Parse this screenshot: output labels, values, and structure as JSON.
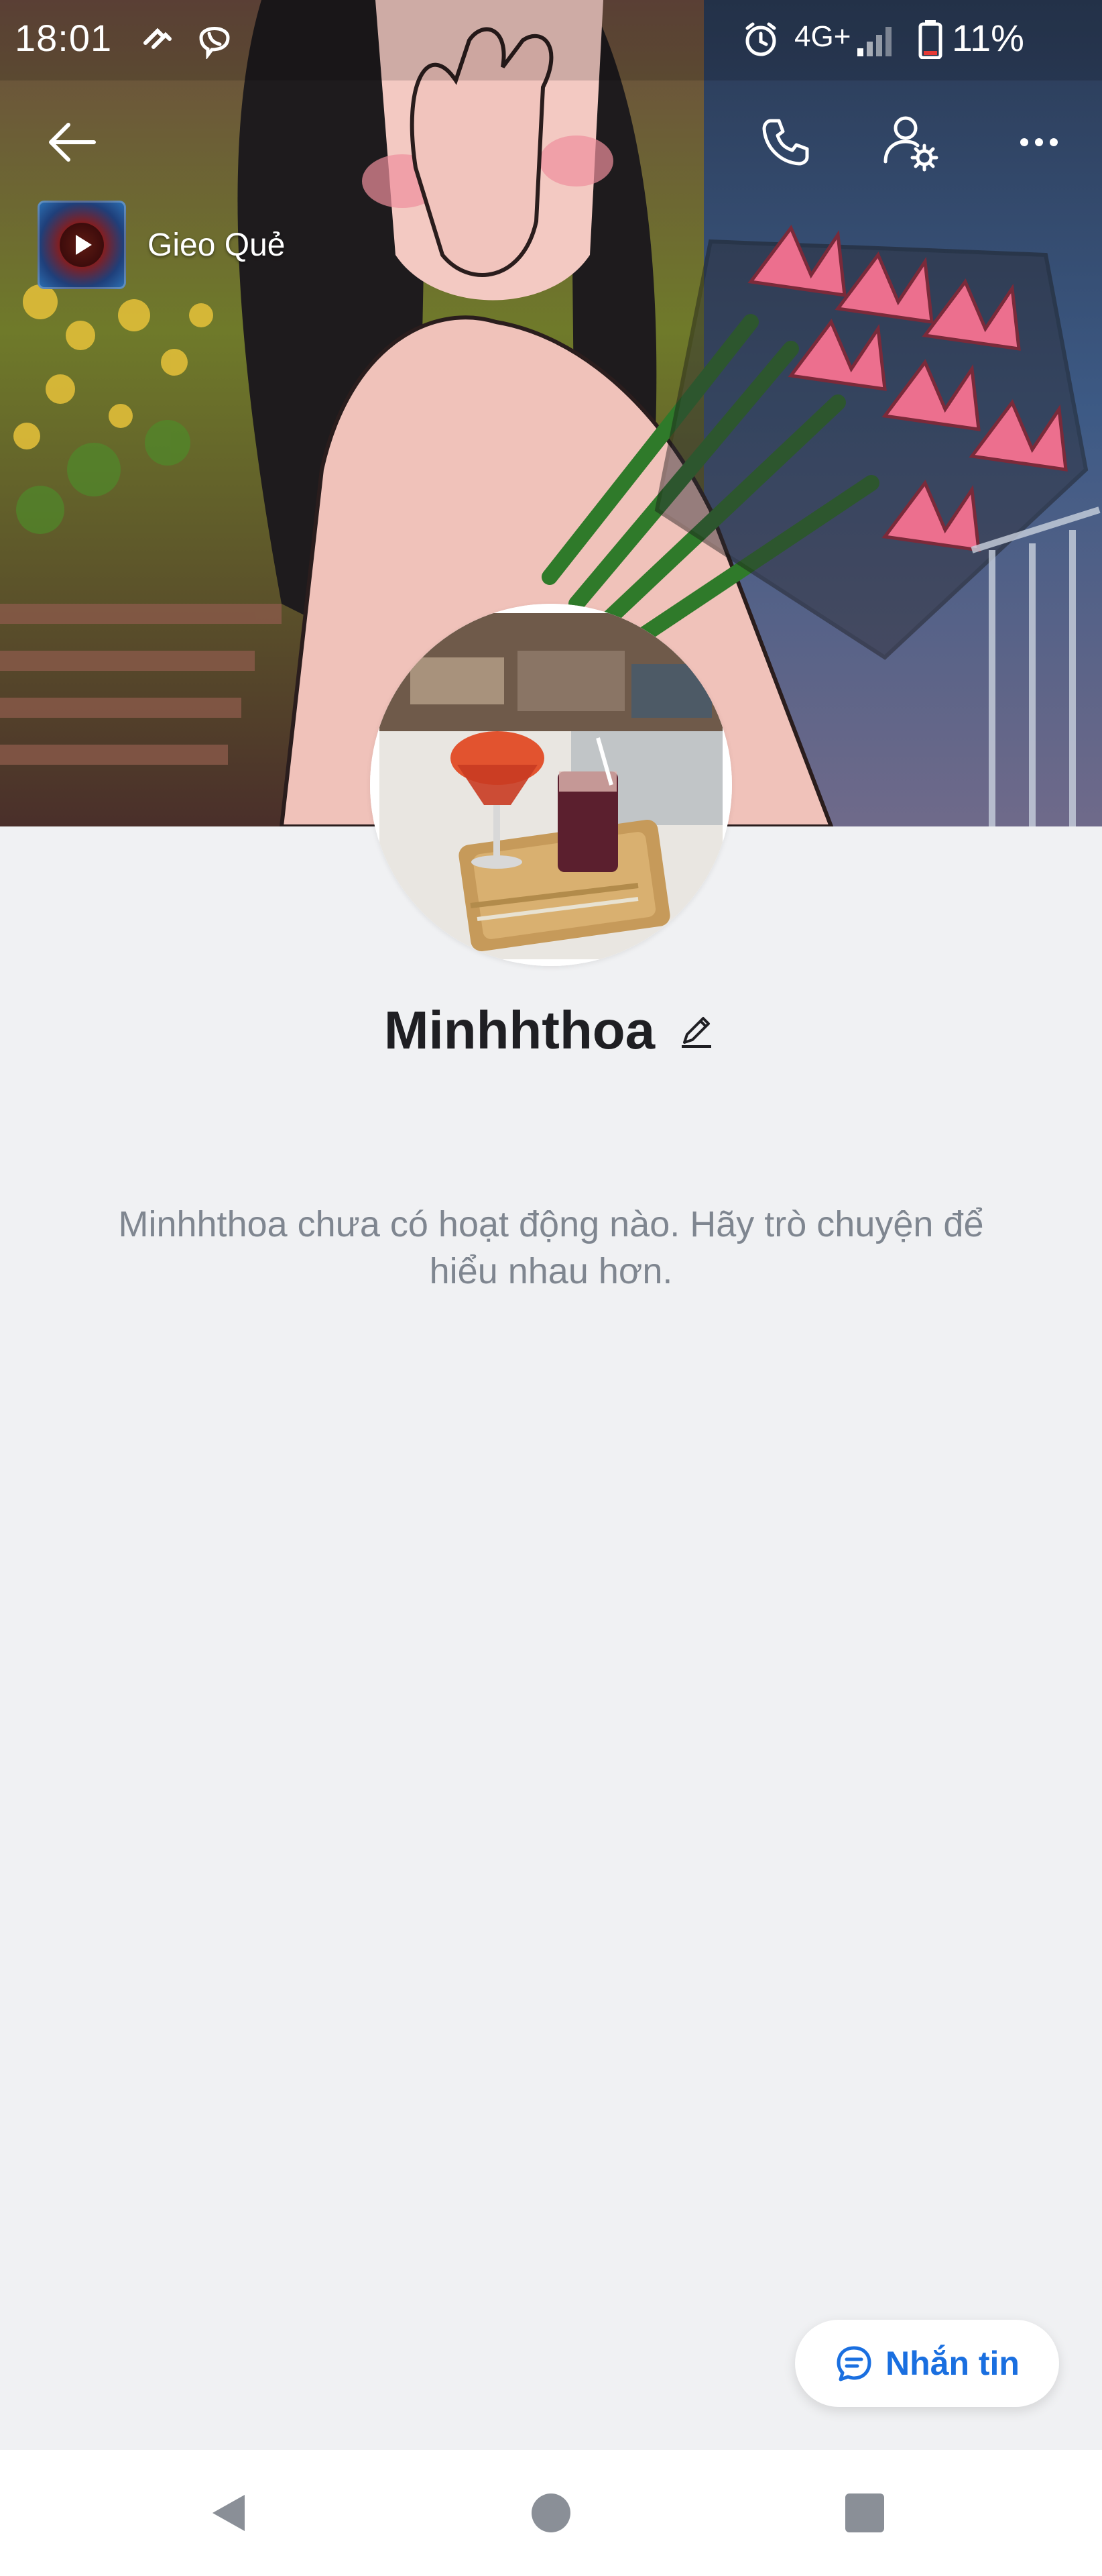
{
  "status_bar": {
    "time": "18:01",
    "network": "4G+",
    "battery": "11%",
    "icons": [
      "sync-icon",
      "viber-icon",
      "alarm-icon",
      "signal-icon",
      "battery-icon"
    ]
  },
  "topbar": {
    "icons": [
      "back-arrow-icon",
      "phone-icon",
      "user-settings-icon",
      "more-icon"
    ]
  },
  "music": {
    "title": "Gieo Quẻ",
    "icon": "play-icon"
  },
  "profile": {
    "name": "Minhhthoa",
    "empty_message": "Minhhthoa chưa có hoạt động nào. Hãy trò chuyện để hiểu nhau hơn."
  },
  "actions": {
    "message_label": "Nhắn tin",
    "message_icon": "chat-bubble-icon"
  },
  "nav": {
    "icons": [
      "nav-back-icon",
      "nav-home-icon",
      "nav-recents-icon"
    ]
  },
  "colors": {
    "accent": "#1a6fe0",
    "background": "#f0f1f3",
    "muted_text": "#7f8690"
  }
}
